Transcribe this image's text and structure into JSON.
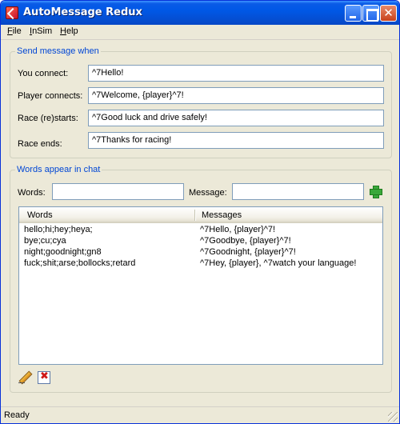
{
  "window": {
    "title": "AutoMessage Redux"
  },
  "menu": [
    {
      "mnemonic": "F",
      "rest": "ile"
    },
    {
      "mnemonic": "I",
      "rest": "nSim"
    },
    {
      "mnemonic": "H",
      "rest": "elp"
    }
  ],
  "send_group": {
    "legend": "Send message when",
    "fields": [
      {
        "label": "You connect:",
        "value": "^7Hello!"
      },
      {
        "label": "Player connects:",
        "value": "^7Welcome, {player}^7!"
      },
      {
        "label": "Race (re)starts:",
        "value": "^7Good luck and drive safely!"
      },
      {
        "label": "Race ends:",
        "value": "^7Thanks for racing!"
      }
    ]
  },
  "words_group": {
    "legend": "Words appear in chat",
    "words_label": "Words:",
    "words_value": "",
    "message_label": "Message:",
    "message_value": "",
    "table": {
      "columns": [
        "Words",
        "Messages"
      ],
      "rows": [
        [
          "hello;hi;hey;heya;",
          "^7Hello, {player}^7!"
        ],
        [
          "bye;cu;cya",
          "^7Goodbye, {player}^7!"
        ],
        [
          "night;goodnight;gn8",
          "^7Goodnight, {player}^7!"
        ],
        [
          "fuck;shit;arse;bollocks;retard",
          "^7Hey, {player}, ^7watch your language!"
        ]
      ]
    }
  },
  "status": {
    "text": "Ready"
  },
  "icons": {
    "add": "plus-icon",
    "edit": "pencil-icon",
    "delete": "delete-x-icon"
  }
}
